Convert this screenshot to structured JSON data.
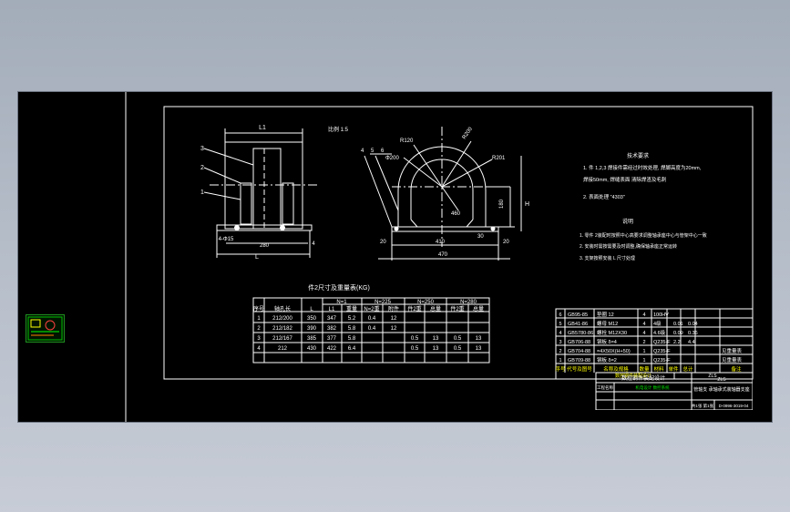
{
  "view": {
    "thumbnail_label": "",
    "colors": {
      "background": "#000000",
      "lines": "#ffffff",
      "highlight": "#ffff00",
      "green": "#00d000",
      "page": "#a9b1bd"
    }
  },
  "left_view": {
    "dims": {
      "top": "L1",
      "bottom": "L",
      "left": "4-Φ15",
      "mid": "280",
      "right": "4"
    },
    "callouts": [
      "3",
      "2",
      "1"
    ]
  },
  "right_view": {
    "scale": "比例 1:5",
    "callouts": [
      "4",
      "5",
      "6"
    ],
    "radii": [
      "R120",
      "R201",
      "R200",
      "Φ200",
      "460"
    ],
    "dims": {
      "bottom1": "20",
      "bottom2": "410",
      "bottom3": "20",
      "overall": "470",
      "height": "180",
      "H": "H",
      "sub": "30"
    }
  },
  "tech_notes": {
    "title": "技术要求",
    "lines": [
      "1. 件 1,2,3  焊接件需经过时效处理, 焊脚高度为20mm,",
      "   焊接50mm, 焊缝表面 清除焊渣及毛刺",
      "2. 表面处理 \"4303\"",
      "说明",
      "1. 零件 2装配时按照中心高要求调整轴承座中心与管架中心一致",
      "2. 安装时需按需要及时调整,确保轴承座正常运转",
      "3. 支架按照安装 L 尺寸处理"
    ]
  },
  "weight_table": {
    "title": "件2尺寸及重量表(KG)",
    "header_top": [
      "序号",
      "轴孔长",
      "L",
      "N=1",
      "N=225",
      "N=250",
      "N=280"
    ],
    "header_sub": [
      "L1",
      "重量",
      "N=2重",
      "附件",
      "件2重",
      "总量",
      "件2重",
      "总量"
    ],
    "rows": [
      [
        "1",
        "212\n200",
        "350",
        "347",
        "5.2",
        "0.4",
        "12",
        "",
        "",
        "",
        ""
      ],
      [
        "2",
        "212\n182",
        "390",
        "382",
        "5.8",
        "0.4",
        "12",
        "",
        "",
        "",
        ""
      ],
      [
        "3",
        "212\n167",
        "385",
        "377",
        "5.8",
        "",
        "",
        "0.5",
        "13",
        "0.5",
        "13"
      ],
      [
        "4",
        "212",
        "430",
        "422",
        "6.4",
        "",
        "",
        "0.5",
        "13",
        "0.5",
        "13"
      ]
    ]
  },
  "bom": {
    "rows": [
      [
        "6",
        "GB95-85",
        "垫圈 12",
        "4",
        "100HV",
        "",
        "",
        ""
      ],
      [
        "5",
        "GB41-86",
        "螺母 M12",
        "4",
        "4级",
        "0.01",
        "0.04",
        ""
      ],
      [
        "4",
        "GB5780-86",
        "螺栓 M12X30",
        "4",
        "4.6级",
        "0.09",
        "0.36",
        ""
      ],
      [
        "3",
        "GB706-88",
        "钢板 δ=4",
        "2",
        "Q235-F",
        "2.2",
        "4.4",
        ""
      ],
      [
        "2",
        "GB704-88",
        "=4X50X(H+50)",
        "1",
        "Q235-F",
        "",
        "",
        "见重量表"
      ],
      [
        "1",
        "GB709-88",
        "钢板 δ=2",
        "1",
        "Q235-F",
        "",
        "",
        "见重量表"
      ]
    ],
    "header": [
      "序号",
      "代号及图号",
      "名称及规格",
      "数量",
      "材料",
      "单件",
      "总计",
      "备注"
    ],
    "weight_label": "重量(kg)"
  },
  "title_block": {
    "title": "数控钢件装配设计",
    "company_label": "工程名称",
    "company": "机电设计 数控系统",
    "part_name": "管轴支 承轴承式装轴器支座",
    "code": "ZLS",
    "drawing_no": "D-0996-3019-04",
    "sheet": "共1张 第1张"
  }
}
